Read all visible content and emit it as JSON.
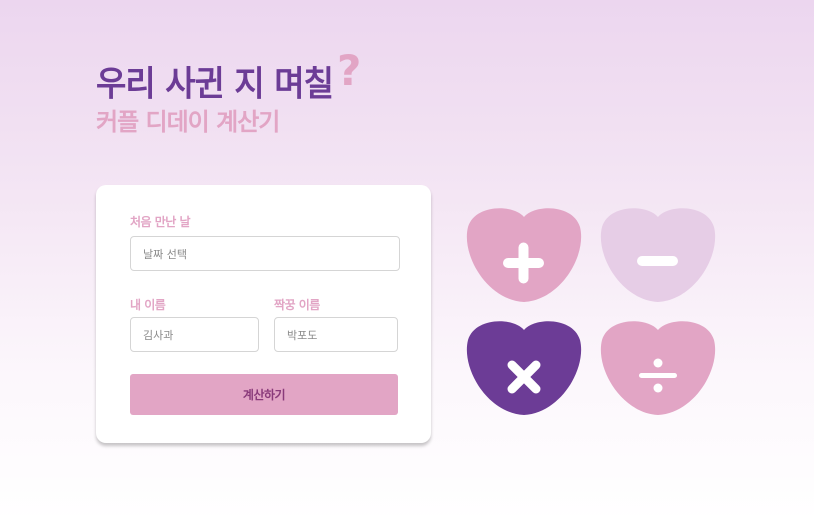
{
  "header": {
    "title": "우리 사귄 지 며칠",
    "title_mark": "?",
    "subtitle": "커플 디데이 계산기"
  },
  "form": {
    "first_met": {
      "label": "처음 만난 날",
      "placeholder": "날짜 선택"
    },
    "my_name": {
      "label": "내 이름",
      "placeholder": "김사과"
    },
    "partner_name": {
      "label": "짝꿍 이름",
      "placeholder": "박포도"
    },
    "submit_label": "계산하기"
  },
  "operators": [
    {
      "symbol": "plus",
      "color": "#e2a5c5"
    },
    {
      "symbol": "minus",
      "color": "#e6cde6"
    },
    {
      "symbol": "multiply",
      "color": "#6c3c96"
    },
    {
      "symbol": "divide",
      "color": "#e2a5c5"
    }
  ],
  "colors": {
    "primary_purple": "#6c3c96",
    "accent_pink": "#e2a5c5",
    "light_lilac": "#e6cde6"
  }
}
